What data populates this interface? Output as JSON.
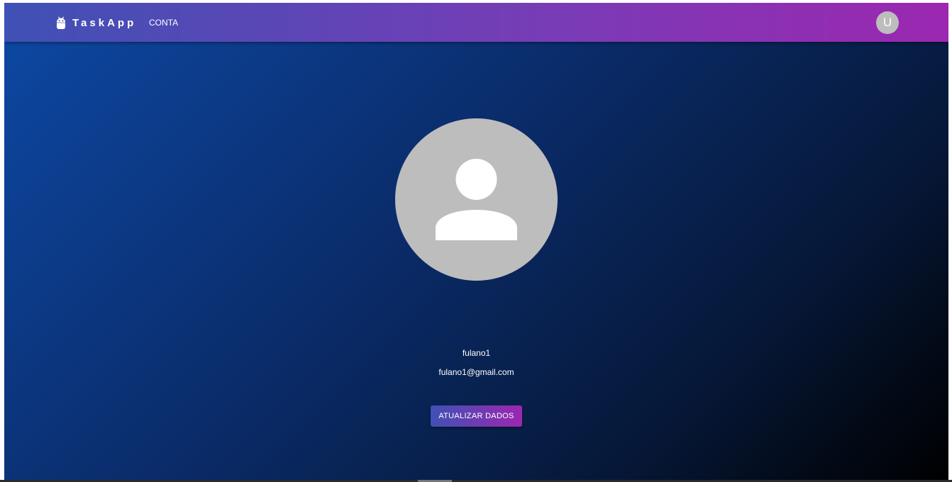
{
  "appbar": {
    "brand_icon": "android-icon",
    "brand_name": "TaskApp",
    "nav_link": "CONTA",
    "avatar_initial": "U"
  },
  "profile": {
    "avatar_icon": "person-icon",
    "username": "fulano1",
    "email": "fulano1@gmail.com",
    "update_button": "ATUALIZAR DADOS"
  },
  "colors": {
    "appbar_start": "#3f51b5",
    "appbar_end": "#9c27b0",
    "background_start": "#0d47a1",
    "background_end": "#000000",
    "avatar_gray": "#bdbdbd"
  }
}
